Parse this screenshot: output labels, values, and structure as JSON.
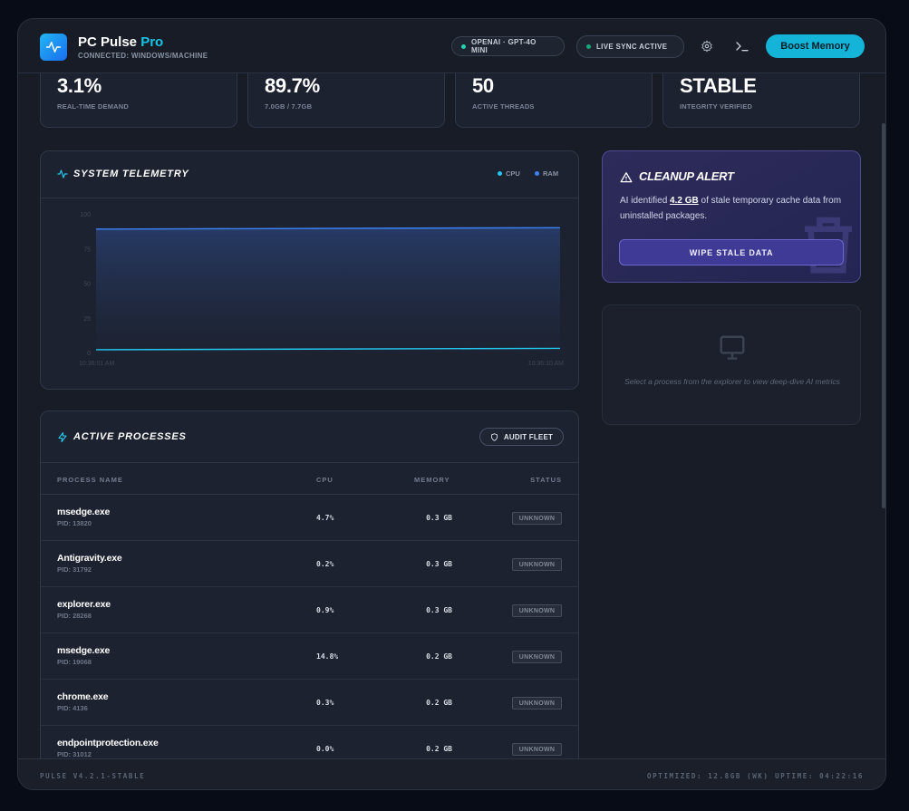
{
  "app": {
    "title_main": "PC Pulse",
    "title_accent": "Pro",
    "subtitle": "CONNECTED: WINDOWS/MACHINE",
    "model_pill": "OPENAI · GPT-4O MINI",
    "sync_pill": "LIVE SYNC ACTIVE",
    "boost_label": "Boost Memory"
  },
  "colors": {
    "accent": "#14b3d8",
    "cpu_series": "#22c8ee",
    "ram_series": "#3b82f6",
    "model_dot": "#1fd2b0",
    "sync_dot": "#1aa47c"
  },
  "stats": [
    {
      "value": "3.1%",
      "label": "REAL-TIME DEMAND"
    },
    {
      "value": "89.7%",
      "label": "7.0GB / 7.7GB"
    },
    {
      "value": "50",
      "label": "ACTIVE THREADS"
    },
    {
      "value": "STABLE",
      "label": "INTEGRITY VERIFIED"
    }
  ],
  "telemetry": {
    "title": "SYSTEM TELEMETRY",
    "legend": [
      "CPU",
      "RAM"
    ]
  },
  "chart_data": {
    "type": "area",
    "title": "SYSTEM TELEMETRY",
    "x": [
      "10:36:01 AM",
      "10:36:10 AM"
    ],
    "ylim": [
      0,
      100
    ],
    "yticks": [
      0,
      25,
      50,
      75,
      100
    ],
    "grid": false,
    "legend_position": "top-right",
    "series": [
      {
        "name": "CPU",
        "values": [
          2,
          3
        ]
      },
      {
        "name": "RAM",
        "values": [
          89,
          90
        ]
      }
    ]
  },
  "alert": {
    "title": "CLEANUP ALERT",
    "body_pre": "AI identified ",
    "body_amount": "4.2 GB",
    "body_post": " of stale temporary cache data from uninstalled packages.",
    "button": "WIPE STALE DATA"
  },
  "detail": {
    "message": "Select a process from the explorer to view deep-dive AI metrics"
  },
  "processes": {
    "title": "ACTIVE PROCESSES",
    "audit_button": "AUDIT FLEET",
    "columns": [
      "PROCESS NAME",
      "CPU",
      "MEMORY",
      "STATUS"
    ],
    "rows": [
      {
        "name": "msedge.exe",
        "pid": "PID: 13820",
        "cpu": "4.7%",
        "mem": "0.3 GB",
        "status": "UNKNOWN"
      },
      {
        "name": "Antigravity.exe",
        "pid": "PID: 31792",
        "cpu": "0.2%",
        "mem": "0.3 GB",
        "status": "UNKNOWN"
      },
      {
        "name": "explorer.exe",
        "pid": "PID: 28268",
        "cpu": "0.9%",
        "mem": "0.3 GB",
        "status": "UNKNOWN"
      },
      {
        "name": "msedge.exe",
        "pid": "PID: 19068",
        "cpu": "14.8%",
        "mem": "0.2 GB",
        "status": "UNKNOWN"
      },
      {
        "name": "chrome.exe",
        "pid": "PID: 4136",
        "cpu": "0.3%",
        "mem": "0.2 GB",
        "status": "UNKNOWN"
      },
      {
        "name": "endpointprotection.exe",
        "pid": "PID: 31012",
        "cpu": "0.0%",
        "mem": "0.2 GB",
        "status": "UNKNOWN"
      }
    ]
  },
  "footer": {
    "version": "PULSE V4.2.1-STABLE",
    "optimized": "OPTIMIZED: 12.8GB (WK)",
    "uptime": "UPTIME: 04:22:16"
  }
}
